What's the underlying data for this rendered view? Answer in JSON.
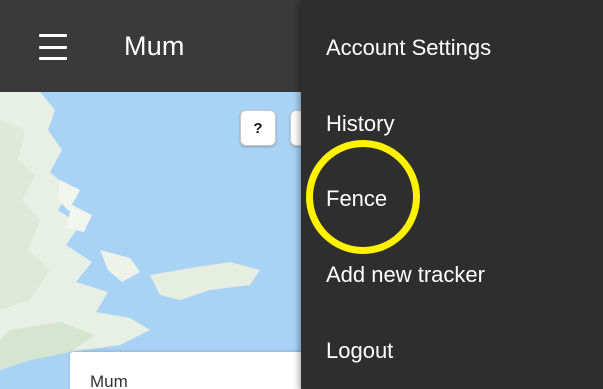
{
  "app_bar": {
    "title": "Mum",
    "menu_icon": "hamburger-icon"
  },
  "map": {
    "help_label": "?",
    "info_card_name": "Mum"
  },
  "menu": {
    "items": [
      {
        "label": "Account Settings"
      },
      {
        "label": "History"
      },
      {
        "label": "Fence"
      },
      {
        "label": "Add new tracker"
      },
      {
        "label": "Logout"
      }
    ],
    "highlighted_item": "Fence"
  },
  "colors": {
    "app_bar": "#3a3a3a",
    "menu_background": "#2e2e2e",
    "map_water": "#a9d3f5",
    "highlight": "#fff200"
  }
}
